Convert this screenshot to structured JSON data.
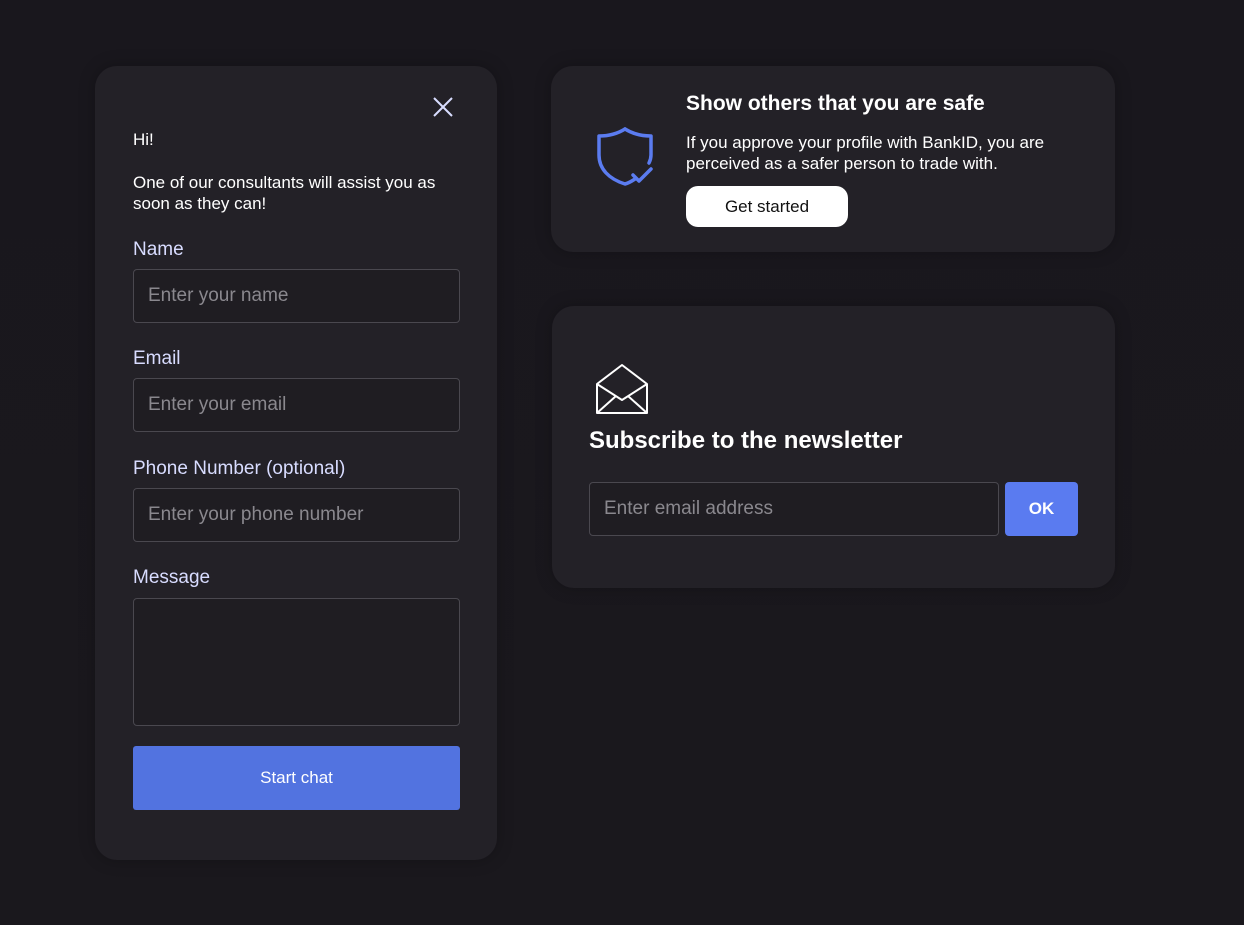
{
  "chat": {
    "close_icon": "close-icon",
    "greeting": "Hi!",
    "intro": "One of our consultants will assist you as soon as they can!",
    "name_label": "Name",
    "name_placeholder": "Enter your name",
    "email_label": "Email",
    "email_placeholder": "Enter your email",
    "phone_label": "Phone Number (optional)",
    "phone_placeholder": "Enter your phone number",
    "message_label": "Message",
    "message_value": "",
    "start_chat_label": "Start chat"
  },
  "bankid": {
    "icon": "shield-check-icon",
    "title": "Show others that you are safe",
    "text": "If you approve your profile with BankID, you are perceived as a safer person to trade with.",
    "button_label": "Get started"
  },
  "newsletter": {
    "icon": "envelope-open-icon",
    "title": "Subscribe to the newsletter",
    "email_placeholder": "Enter email address",
    "ok_label": "OK"
  },
  "colors": {
    "background": "#19171d",
    "card": "#232127",
    "accent": "#5273e0",
    "ok_button": "#5a7bf0",
    "label": "#d8dcff",
    "shield": "#5b7cf0"
  }
}
